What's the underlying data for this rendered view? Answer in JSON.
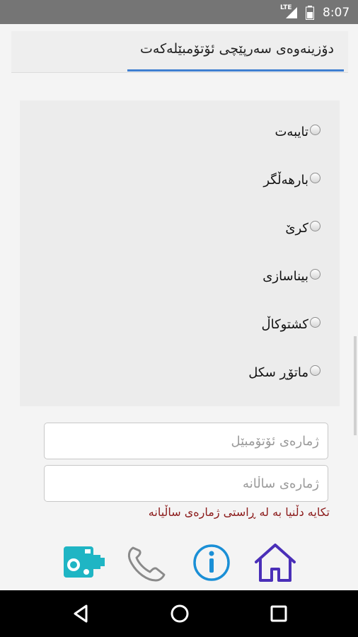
{
  "status_bar": {
    "network": "LTE",
    "time": "8:07"
  },
  "header": {
    "title": "دۆزینەوەی سەرپێچی ئۆتۆمبێلەکەت"
  },
  "vehicle_types": {
    "options": [
      {
        "label": "تایبەت"
      },
      {
        "label": "بارهەڵگر"
      },
      {
        "label": "کرێ"
      },
      {
        "label": "بیناسازی"
      },
      {
        "label": "کشتوکاڵ"
      },
      {
        "label": "ماتۆڕ سکل"
      }
    ]
  },
  "form": {
    "car_number_placeholder": "ژمارەی ئۆتۆمبێل",
    "annual_number_placeholder": "ژمارەی ساڵانە",
    "hint": "تکایە دڵنیا بە لە ڕاستی ژمارەی ساڵیانە"
  },
  "toolbar": {
    "icons": [
      "speed-camera-icon",
      "phone-icon",
      "info-icon",
      "home-icon"
    ]
  },
  "nav": {
    "icons": [
      "back-icon",
      "home-circle-icon",
      "recents-icon"
    ]
  },
  "colors": {
    "camera": "#1fb5c4",
    "phone": "#8a8a8a",
    "info": "#1a8fd6",
    "home": "#4a2fb8",
    "accent_underline": "#3f7fd1",
    "hint_text": "#8b1a1a"
  }
}
